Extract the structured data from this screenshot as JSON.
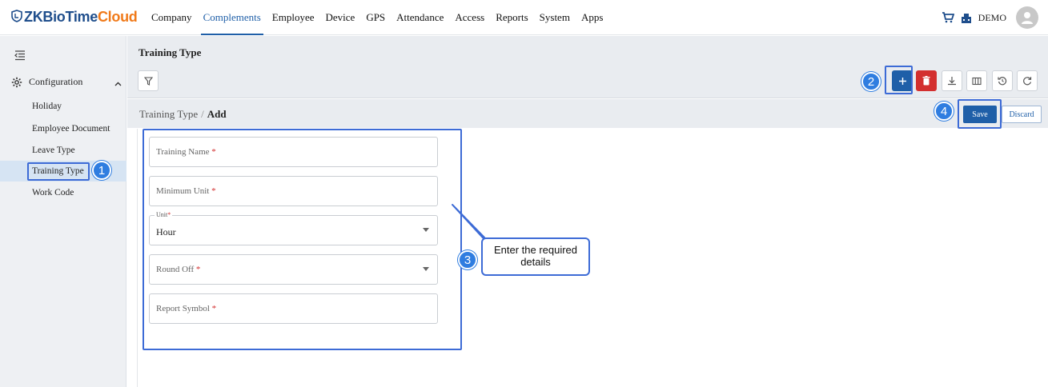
{
  "logo": {
    "part1": "ZKBioTime",
    "part2": "Cloud"
  },
  "nav": [
    {
      "label": "Company",
      "active": false
    },
    {
      "label": "Complements",
      "active": true
    },
    {
      "label": "Employee",
      "active": false
    },
    {
      "label": "Device",
      "active": false
    },
    {
      "label": "GPS",
      "active": false
    },
    {
      "label": "Attendance",
      "active": false
    },
    {
      "label": "Access",
      "active": false
    },
    {
      "label": "Reports",
      "active": false
    },
    {
      "label": "System",
      "active": false
    },
    {
      "label": "Apps",
      "active": false
    }
  ],
  "user": {
    "name": "DEMO"
  },
  "sidebar": {
    "section": "Configuration",
    "items": [
      {
        "label": "Holiday"
      },
      {
        "label": "Employee Document"
      },
      {
        "label": "Leave Type"
      },
      {
        "label": "Training Type",
        "selected": true
      },
      {
        "label": "Work Code"
      }
    ]
  },
  "page": {
    "title": "Training Type"
  },
  "breadcrumb": {
    "parent": "Training Type",
    "separator": "/",
    "current": "Add"
  },
  "actions": {
    "save": "Save",
    "discard": "Discard"
  },
  "form": {
    "training_name": {
      "label": "Training Name",
      "required_mark": "*"
    },
    "minimum_unit": {
      "label": "Minimum Unit",
      "required_mark": "*"
    },
    "unit": {
      "label": "Unit",
      "required_mark": "*",
      "value": "Hour"
    },
    "round_off": {
      "label": "Round Off",
      "required_mark": "*"
    },
    "report_symbol": {
      "label": "Report Symbol",
      "required_mark": "*"
    }
  },
  "annotations": {
    "step1": "1",
    "step2": "2",
    "step3": "3",
    "step4": "4",
    "tooltip_line1": "Enter the required",
    "tooltip_line2": "details"
  },
  "colors": {
    "brand_blue": "#1f4e8c",
    "brand_orange": "#f07a1a",
    "primary": "#1f5fa8",
    "danger": "#d32f2f",
    "annotation": "#3d6bd6"
  }
}
